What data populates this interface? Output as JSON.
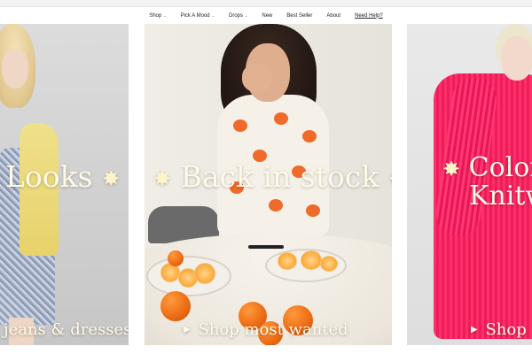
{
  "nav": {
    "items": [
      {
        "label": "Shop",
        "has_dropdown": true
      },
      {
        "label": "Pick A Mood",
        "has_dropdown": true
      },
      {
        "label": "Drops",
        "has_dropdown": true
      },
      {
        "label": "New",
        "has_dropdown": false
      },
      {
        "label": "Best Seller",
        "has_dropdown": false
      },
      {
        "label": "About",
        "has_dropdown": false
      },
      {
        "label": "Need Help?",
        "has_dropdown": false
      }
    ]
  },
  "panels": [
    {
      "headline": "Looks",
      "cta": "jeans & dresses",
      "accent": "#c9d2e2"
    },
    {
      "headline": "Back in stock",
      "cta": "Shop most wanted",
      "accent": "#f06a2a"
    },
    {
      "headline_line1": "Color",
      "headline_line2": "Knitw",
      "cta": "Shop",
      "accent": "#ff2f6a"
    }
  ],
  "icons": {
    "sparkle": "✸",
    "play": "▶",
    "chevron": "⌄"
  }
}
